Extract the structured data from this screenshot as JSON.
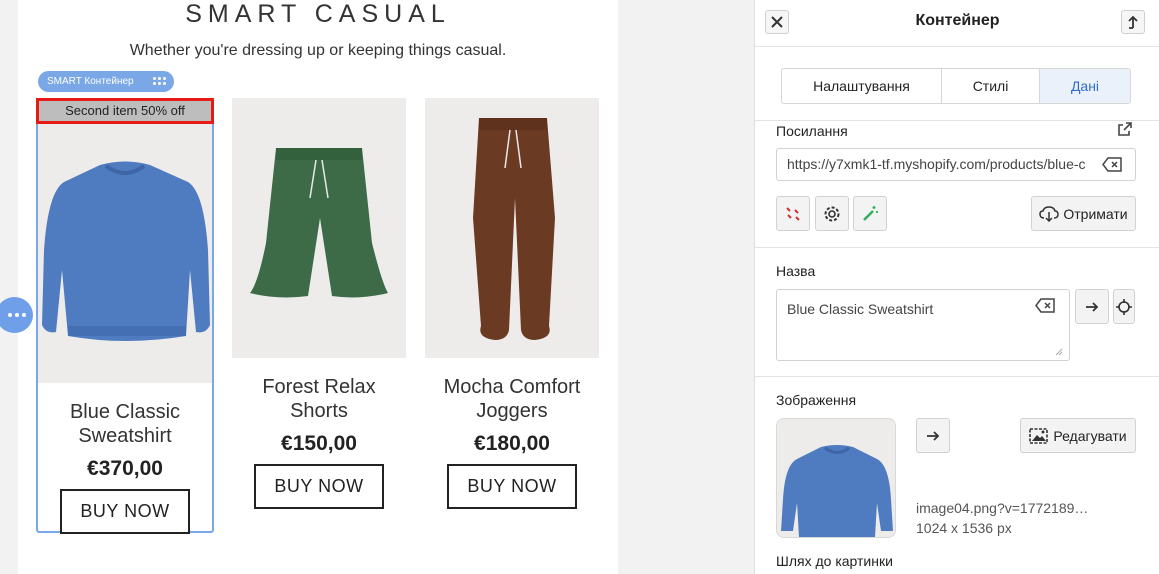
{
  "store": {
    "title": "SMART CASUAL",
    "subtitle": "Whether you're dressing up or keeping things casual.",
    "container_label": "SMART Контейнер",
    "badge": "Second item 50% off",
    "buy_label": "BUY NOW",
    "products": [
      {
        "name": "Blue Classic Sweatshirt",
        "price": "€370,00",
        "color": "#4f7bc0"
      },
      {
        "name": "Forest Relax Shorts",
        "price": "€150,00",
        "color": "#3d6b47"
      },
      {
        "name": "Mocha Comfort Joggers",
        "price": "€180,00",
        "color": "#6b3a22"
      }
    ]
  },
  "panel": {
    "title": "Контейнер",
    "tabs": [
      {
        "label": "Налаштування",
        "active": false
      },
      {
        "label": "Стилі",
        "active": false
      },
      {
        "label": "Дані",
        "active": true
      }
    ],
    "link": {
      "label": "Посилання",
      "value": "https://y7xmk1-tf.myshopify.com/products/blue-c",
      "fetch_label": "Отримати"
    },
    "name": {
      "label": "Назва",
      "value": "Blue Classic Sweatshirt"
    },
    "image": {
      "label": "Зображення",
      "edit_label": "Редагувати",
      "filename": "image04.png?v=1772189…",
      "size": "1024 x 1536 px",
      "path_label": "Шлях до картинки"
    }
  },
  "colors": {
    "accent": "#7aa7e6",
    "badge_border": "#e41b17",
    "active_tab_text": "#2f6fc9"
  }
}
